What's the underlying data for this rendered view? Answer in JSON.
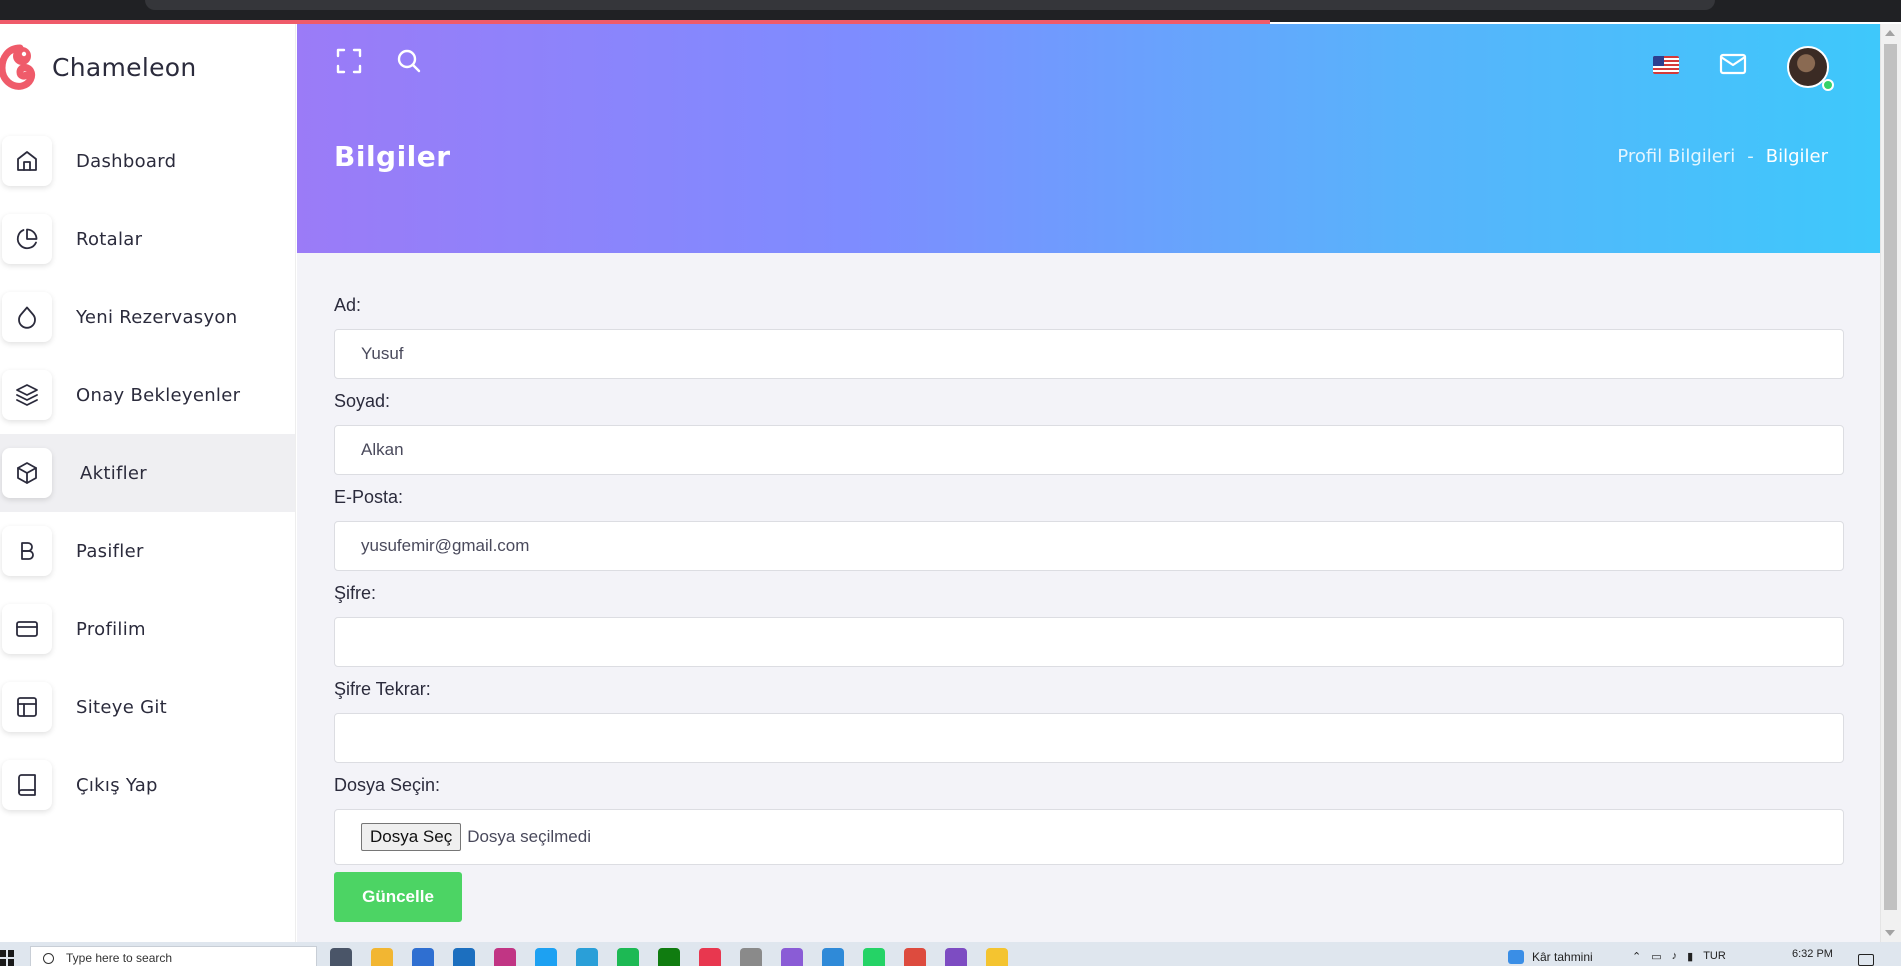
{
  "brand": {
    "name": "Chameleon"
  },
  "sidebar": {
    "items": [
      {
        "label": "Dashboard",
        "icon": "home-icon",
        "active": false
      },
      {
        "label": "Rotalar",
        "icon": "pie-chart-icon",
        "active": false
      },
      {
        "label": "Yeni Rezervasyon",
        "icon": "droplet-icon",
        "active": false
      },
      {
        "label": "Onay Bekleyenler",
        "icon": "layers-icon",
        "active": false
      },
      {
        "label": "Aktifler",
        "icon": "box-icon",
        "active": true
      },
      {
        "label": "Pasifler",
        "icon": "bold-icon",
        "active": false
      },
      {
        "label": "Profilim",
        "icon": "credit-card-icon",
        "active": false
      },
      {
        "label": "Siteye Git",
        "icon": "layout-icon",
        "active": false
      },
      {
        "label": "Çıkış Yap",
        "icon": "book-icon",
        "active": false
      }
    ]
  },
  "header": {
    "title": "Bilgiler",
    "breadcrumb": {
      "parent": "Profil Bilgileri",
      "separator": "-",
      "current": "Bilgiler"
    },
    "icons": [
      "fullscreen-icon",
      "search-icon",
      "us-flag-icon",
      "mail-icon",
      "avatar"
    ]
  },
  "form": {
    "first_name": {
      "label": "Ad:",
      "value": "Yusuf"
    },
    "last_name": {
      "label": "Soyad:",
      "value": "Alkan"
    },
    "email": {
      "label": "E-Posta:",
      "value": "yusufemir@gmail.com"
    },
    "password": {
      "label": "Şifre:",
      "value": ""
    },
    "password_repeat": {
      "label": "Şifre Tekrar:",
      "value": ""
    },
    "file": {
      "label": "Dosya Seçin:",
      "button": "Dosya Seç",
      "status": "Dosya seçilmedi"
    },
    "submit_label": "Güncelle"
  },
  "taskbar": {
    "search_placeholder": "Type here to search",
    "weather": "Kâr tahmini",
    "language": "TUR",
    "time": "6:32 PM"
  },
  "colors": {
    "accent_green": "#4cd464",
    "header_gradient_start": "#9b7bf7",
    "header_gradient_end": "#3ec8fb",
    "brand_red": "#ef5b6a"
  }
}
